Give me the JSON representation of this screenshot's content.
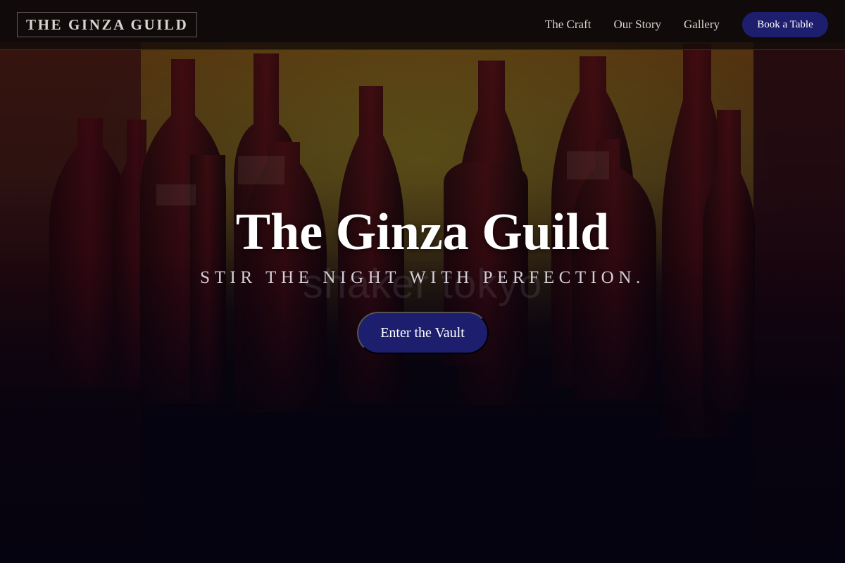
{
  "brand": {
    "logo_text": "THE GINZA GUILD"
  },
  "nav": {
    "items": [
      {
        "label": "The Craft"
      },
      {
        "label": "Our Story"
      },
      {
        "label": "Gallery"
      }
    ],
    "cta_label": "Book a Table"
  },
  "hero": {
    "title": "The Ginza Guild",
    "tagline": "STIR THE NIGHT WITH PERFECTION.",
    "cta_label": "Enter the Vault",
    "background_watermark": "shaker tokyo"
  },
  "colors": {
    "accent": "#1d1f6e",
    "background": "#05030f"
  }
}
